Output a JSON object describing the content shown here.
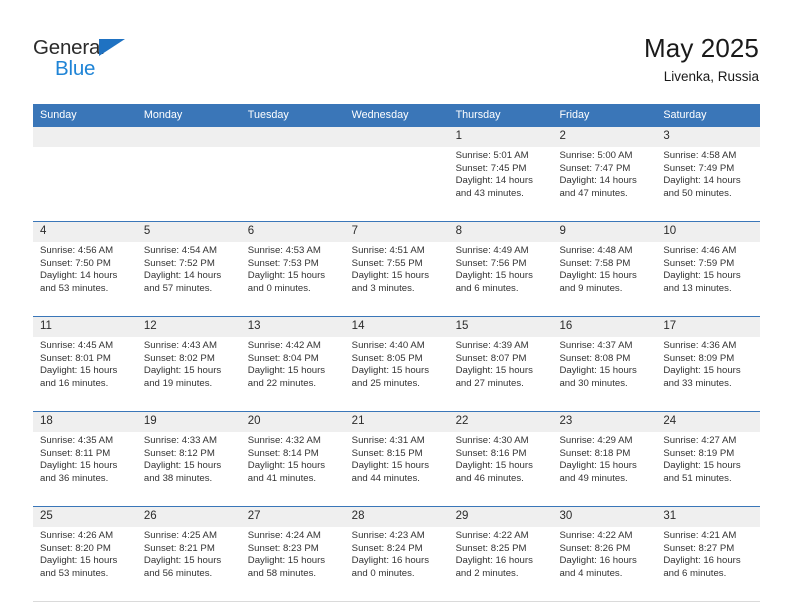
{
  "logo": {
    "word1": "General",
    "word2": "Blue",
    "triangle_color": "#1F72C2",
    "word2_color": "#1F84D6"
  },
  "header": {
    "title": "May 2025",
    "location": "Livenka, Russia"
  },
  "theme": {
    "header_bg": "#3A76B8",
    "number_band_bg": "#EFEFEF",
    "rule_color": "#3A76B8"
  },
  "weekdays": [
    "Sunday",
    "Monday",
    "Tuesday",
    "Wednesday",
    "Thursday",
    "Friday",
    "Saturday"
  ],
  "weeks": [
    [
      {
        "day": "",
        "sunrise": "",
        "sunset": "",
        "daylight1": "",
        "daylight2": ""
      },
      {
        "day": "",
        "sunrise": "",
        "sunset": "",
        "daylight1": "",
        "daylight2": ""
      },
      {
        "day": "",
        "sunrise": "",
        "sunset": "",
        "daylight1": "",
        "daylight2": ""
      },
      {
        "day": "",
        "sunrise": "",
        "sunset": "",
        "daylight1": "",
        "daylight2": ""
      },
      {
        "day": "1",
        "sunrise": "Sunrise: 5:01 AM",
        "sunset": "Sunset: 7:45 PM",
        "daylight1": "Daylight: 14 hours",
        "daylight2": "and 43 minutes."
      },
      {
        "day": "2",
        "sunrise": "Sunrise: 5:00 AM",
        "sunset": "Sunset: 7:47 PM",
        "daylight1": "Daylight: 14 hours",
        "daylight2": "and 47 minutes."
      },
      {
        "day": "3",
        "sunrise": "Sunrise: 4:58 AM",
        "sunset": "Sunset: 7:49 PM",
        "daylight1": "Daylight: 14 hours",
        "daylight2": "and 50 minutes."
      }
    ],
    [
      {
        "day": "4",
        "sunrise": "Sunrise: 4:56 AM",
        "sunset": "Sunset: 7:50 PM",
        "daylight1": "Daylight: 14 hours",
        "daylight2": "and 53 minutes."
      },
      {
        "day": "5",
        "sunrise": "Sunrise: 4:54 AM",
        "sunset": "Sunset: 7:52 PM",
        "daylight1": "Daylight: 14 hours",
        "daylight2": "and 57 minutes."
      },
      {
        "day": "6",
        "sunrise": "Sunrise: 4:53 AM",
        "sunset": "Sunset: 7:53 PM",
        "daylight1": "Daylight: 15 hours",
        "daylight2": "and 0 minutes."
      },
      {
        "day": "7",
        "sunrise": "Sunrise: 4:51 AM",
        "sunset": "Sunset: 7:55 PM",
        "daylight1": "Daylight: 15 hours",
        "daylight2": "and 3 minutes."
      },
      {
        "day": "8",
        "sunrise": "Sunrise: 4:49 AM",
        "sunset": "Sunset: 7:56 PM",
        "daylight1": "Daylight: 15 hours",
        "daylight2": "and 6 minutes."
      },
      {
        "day": "9",
        "sunrise": "Sunrise: 4:48 AM",
        "sunset": "Sunset: 7:58 PM",
        "daylight1": "Daylight: 15 hours",
        "daylight2": "and 9 minutes."
      },
      {
        "day": "10",
        "sunrise": "Sunrise: 4:46 AM",
        "sunset": "Sunset: 7:59 PM",
        "daylight1": "Daylight: 15 hours",
        "daylight2": "and 13 minutes."
      }
    ],
    [
      {
        "day": "11",
        "sunrise": "Sunrise: 4:45 AM",
        "sunset": "Sunset: 8:01 PM",
        "daylight1": "Daylight: 15 hours",
        "daylight2": "and 16 minutes."
      },
      {
        "day": "12",
        "sunrise": "Sunrise: 4:43 AM",
        "sunset": "Sunset: 8:02 PM",
        "daylight1": "Daylight: 15 hours",
        "daylight2": "and 19 minutes."
      },
      {
        "day": "13",
        "sunrise": "Sunrise: 4:42 AM",
        "sunset": "Sunset: 8:04 PM",
        "daylight1": "Daylight: 15 hours",
        "daylight2": "and 22 minutes."
      },
      {
        "day": "14",
        "sunrise": "Sunrise: 4:40 AM",
        "sunset": "Sunset: 8:05 PM",
        "daylight1": "Daylight: 15 hours",
        "daylight2": "and 25 minutes."
      },
      {
        "day": "15",
        "sunrise": "Sunrise: 4:39 AM",
        "sunset": "Sunset: 8:07 PM",
        "daylight1": "Daylight: 15 hours",
        "daylight2": "and 27 minutes."
      },
      {
        "day": "16",
        "sunrise": "Sunrise: 4:37 AM",
        "sunset": "Sunset: 8:08 PM",
        "daylight1": "Daylight: 15 hours",
        "daylight2": "and 30 minutes."
      },
      {
        "day": "17",
        "sunrise": "Sunrise: 4:36 AM",
        "sunset": "Sunset: 8:09 PM",
        "daylight1": "Daylight: 15 hours",
        "daylight2": "and 33 minutes."
      }
    ],
    [
      {
        "day": "18",
        "sunrise": "Sunrise: 4:35 AM",
        "sunset": "Sunset: 8:11 PM",
        "daylight1": "Daylight: 15 hours",
        "daylight2": "and 36 minutes."
      },
      {
        "day": "19",
        "sunrise": "Sunrise: 4:33 AM",
        "sunset": "Sunset: 8:12 PM",
        "daylight1": "Daylight: 15 hours",
        "daylight2": "and 38 minutes."
      },
      {
        "day": "20",
        "sunrise": "Sunrise: 4:32 AM",
        "sunset": "Sunset: 8:14 PM",
        "daylight1": "Daylight: 15 hours",
        "daylight2": "and 41 minutes."
      },
      {
        "day": "21",
        "sunrise": "Sunrise: 4:31 AM",
        "sunset": "Sunset: 8:15 PM",
        "daylight1": "Daylight: 15 hours",
        "daylight2": "and 44 minutes."
      },
      {
        "day": "22",
        "sunrise": "Sunrise: 4:30 AM",
        "sunset": "Sunset: 8:16 PM",
        "daylight1": "Daylight: 15 hours",
        "daylight2": "and 46 minutes."
      },
      {
        "day": "23",
        "sunrise": "Sunrise: 4:29 AM",
        "sunset": "Sunset: 8:18 PM",
        "daylight1": "Daylight: 15 hours",
        "daylight2": "and 49 minutes."
      },
      {
        "day": "24",
        "sunrise": "Sunrise: 4:27 AM",
        "sunset": "Sunset: 8:19 PM",
        "daylight1": "Daylight: 15 hours",
        "daylight2": "and 51 minutes."
      }
    ],
    [
      {
        "day": "25",
        "sunrise": "Sunrise: 4:26 AM",
        "sunset": "Sunset: 8:20 PM",
        "daylight1": "Daylight: 15 hours",
        "daylight2": "and 53 minutes."
      },
      {
        "day": "26",
        "sunrise": "Sunrise: 4:25 AM",
        "sunset": "Sunset: 8:21 PM",
        "daylight1": "Daylight: 15 hours",
        "daylight2": "and 56 minutes."
      },
      {
        "day": "27",
        "sunrise": "Sunrise: 4:24 AM",
        "sunset": "Sunset: 8:23 PM",
        "daylight1": "Daylight: 15 hours",
        "daylight2": "and 58 minutes."
      },
      {
        "day": "28",
        "sunrise": "Sunrise: 4:23 AM",
        "sunset": "Sunset: 8:24 PM",
        "daylight1": "Daylight: 16 hours",
        "daylight2": "and 0 minutes."
      },
      {
        "day": "29",
        "sunrise": "Sunrise: 4:22 AM",
        "sunset": "Sunset: 8:25 PM",
        "daylight1": "Daylight: 16 hours",
        "daylight2": "and 2 minutes."
      },
      {
        "day": "30",
        "sunrise": "Sunrise: 4:22 AM",
        "sunset": "Sunset: 8:26 PM",
        "daylight1": "Daylight: 16 hours",
        "daylight2": "and 4 minutes."
      },
      {
        "day": "31",
        "sunrise": "Sunrise: 4:21 AM",
        "sunset": "Sunset: 8:27 PM",
        "daylight1": "Daylight: 16 hours",
        "daylight2": "and 6 minutes."
      }
    ]
  ]
}
